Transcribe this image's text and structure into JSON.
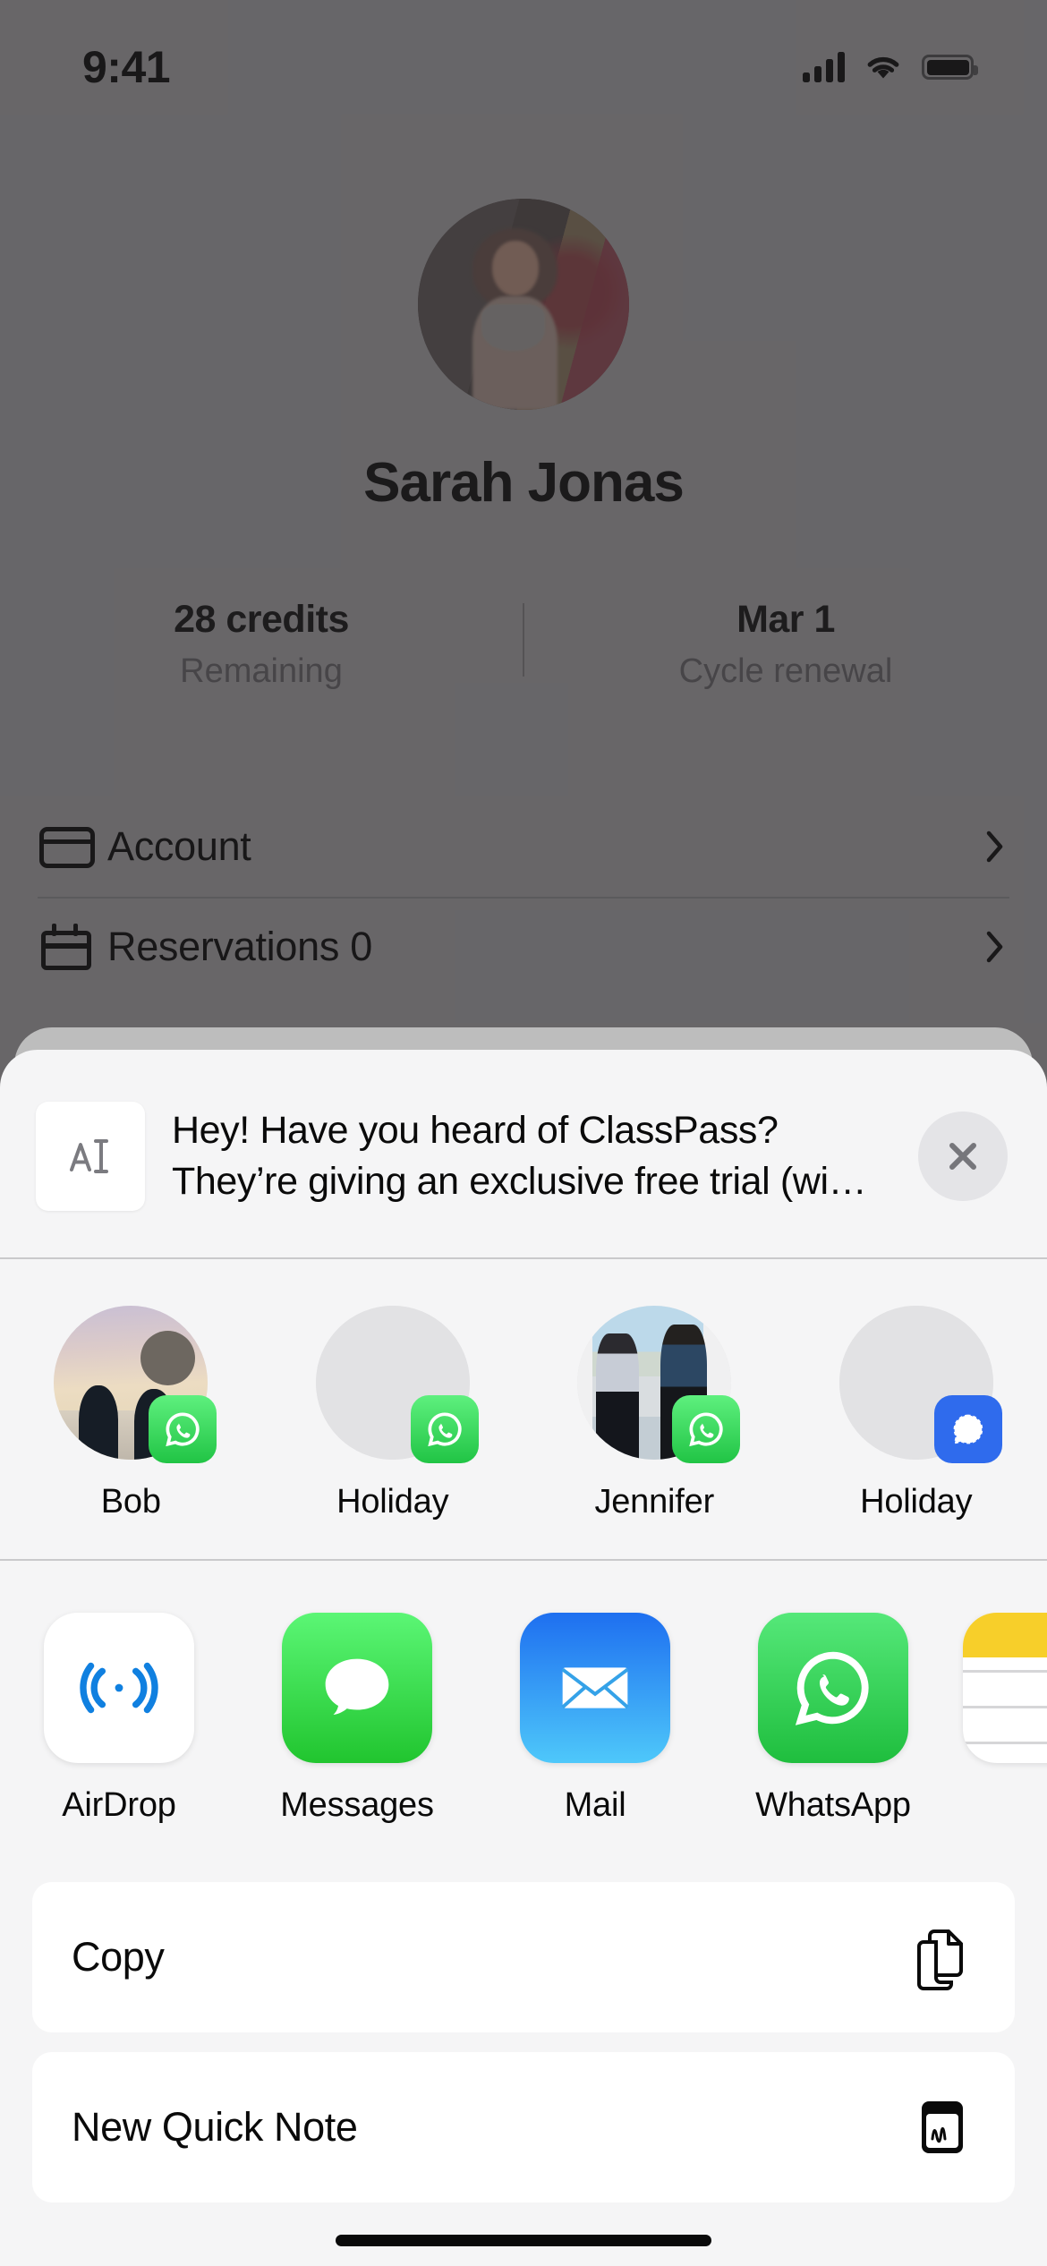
{
  "status_bar": {
    "time": "9:41",
    "cellular_icon": "cellular-bars-icon",
    "wifi_icon": "wifi-icon",
    "battery_icon": "battery-full-icon"
  },
  "background_app": {
    "profile": {
      "avatar_icon": "profile-avatar",
      "name": "Sarah Jonas"
    },
    "stats": [
      {
        "value": "28 credits",
        "label": "Remaining"
      },
      {
        "value": "Mar 1",
        "label": "Cycle renewal"
      }
    ],
    "menu_rows": [
      {
        "icon": "credit-card-icon",
        "label": "Account",
        "chevron": "chevron-right-icon"
      },
      {
        "icon": "calendar-icon",
        "label": "Reservations  0",
        "chevron": "chevron-right-icon"
      }
    ]
  },
  "share_sheet": {
    "grabber_icon": "sheet-grabber",
    "preview": {
      "thumbnail_icon": "text-document-icon",
      "thumbnail_glyph": "A",
      "line1": "Hey! Have you heard of ClassPass?",
      "line2": "They’re giving an exclusive free trial (wi…",
      "close_icon": "close-icon"
    },
    "contacts": [
      {
        "name": "Bob",
        "avatar": "photo-sunset-silhouettes",
        "app_badge": "whatsapp-badge-icon",
        "badge_color": "#25c447"
      },
      {
        "name": "Holiday",
        "avatar": "placeholder-avatar",
        "app_badge": "whatsapp-badge-icon",
        "badge_color": "#25c447"
      },
      {
        "name": "Jennifer",
        "avatar": "photo-two-people-handshake",
        "app_badge": "whatsapp-badge-icon",
        "badge_color": "#25c447"
      },
      {
        "name": "Holiday",
        "avatar": "placeholder-avatar",
        "app_badge": "signal-badge-icon",
        "badge_color": "#2f6bed"
      }
    ],
    "apps": [
      {
        "name": "AirDrop",
        "icon": "airdrop-icon"
      },
      {
        "name": "Messages",
        "icon": "messages-icon"
      },
      {
        "name": "Mail",
        "icon": "mail-icon"
      },
      {
        "name": "WhatsApp",
        "icon": "whatsapp-icon"
      },
      {
        "name": "",
        "icon": "notes-icon"
      }
    ],
    "actions": [
      {
        "label": "Copy",
        "icon": "copy-icon"
      },
      {
        "label": "New Quick Note",
        "icon": "quick-note-icon"
      }
    ]
  },
  "home_indicator_icon": "home-indicator"
}
